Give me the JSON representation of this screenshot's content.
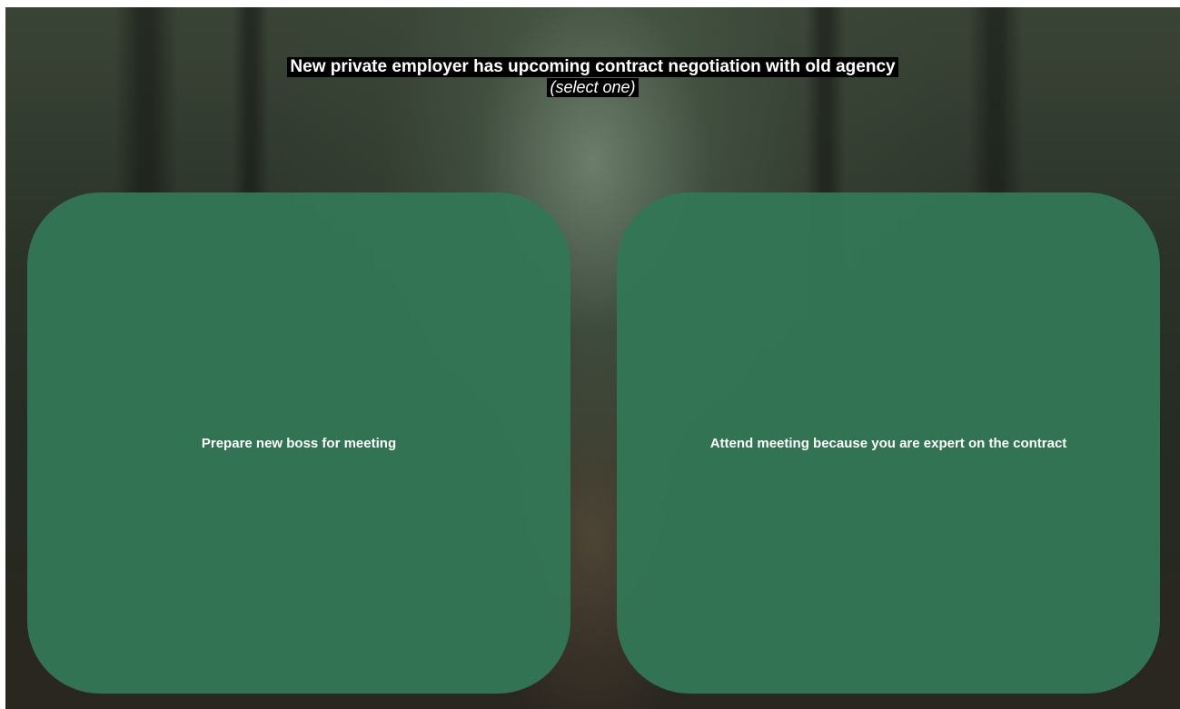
{
  "question": {
    "title": "New private employer has upcoming contract negotiation with old agency",
    "instruction": "(select one)"
  },
  "choices": [
    {
      "label": "Prepare new boss for meeting"
    },
    {
      "label": "Attend meeting because you are expert on the contract"
    }
  ],
  "colors": {
    "choice_card": "#337656",
    "prompt_background": "#000000",
    "text": "#ffffff"
  },
  "background": {
    "icon": "forest-photo"
  }
}
